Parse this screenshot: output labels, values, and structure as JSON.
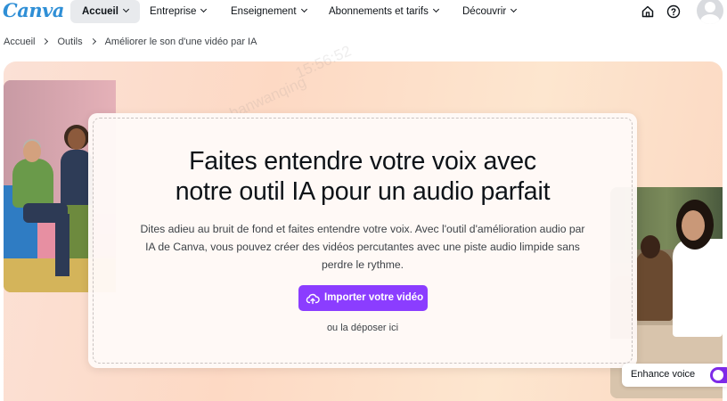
{
  "nav": {
    "logo": "Canva",
    "items": [
      {
        "label": "Accueil",
        "active": true
      },
      {
        "label": "Entreprise",
        "active": false
      },
      {
        "label": "Enseignement",
        "active": false
      },
      {
        "label": "Abonnements et tarifs",
        "active": false
      },
      {
        "label": "Découvrir",
        "active": false
      }
    ],
    "icons": [
      "home-icon",
      "help-icon",
      "avatar"
    ]
  },
  "breadcrumb": [
    "Accueil",
    "Outils",
    "Améliorer le son d'une vidéo par IA"
  ],
  "hero": {
    "headline_line1": "Faites entendre votre voix avec",
    "headline_line2": "notre outil IA pour un audio parfait",
    "description_line1": "Dites adieu au bruit de fond et faites entendre votre voix. Avec l'outil d'amélioration audio par",
    "description_line2": "IA de Canva, vous pouvez créer des vidéos percutantes avec une piste audio limpide sans",
    "description_line3": "perdre le rythme.",
    "upload_label": "Importer votre vidéo",
    "drop_label": "ou la déposer ici"
  },
  "enhance": {
    "label": "Enhance voice",
    "enabled": true
  },
  "watermark": {
    "user": "hanwanqing",
    "time": "15:56:52"
  },
  "colors": {
    "accent": "#8b3dff",
    "logo": "#2f8fd6",
    "toggle": "#7d2ae8"
  }
}
